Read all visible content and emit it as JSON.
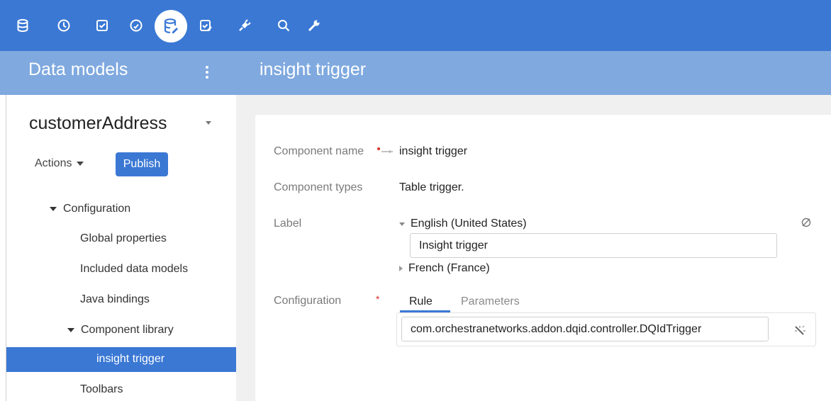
{
  "toolbar": {
    "icons": [
      "database-icon",
      "clock-icon",
      "checkbox-icon",
      "gauge-icon",
      "data-model-icon",
      "edit-check-icon",
      "plug-icon",
      "search-icon",
      "wrench-icon"
    ],
    "active_icon": "data-model-icon",
    "color": "#3a78d4"
  },
  "header": {
    "left_title": "Data models",
    "right_title": "insight trigger",
    "color": "#7fa9df"
  },
  "sidebar": {
    "model_name": "customerAddress",
    "actions_label": "Actions",
    "publish_label": "Publish",
    "tree": {
      "configuration": "Configuration",
      "global_properties": "Global properties",
      "included_data_models": "Included data models",
      "java_bindings": "Java bindings",
      "component_library": "Component library",
      "selected_item": "insight trigger",
      "toolbars": "Toolbars"
    }
  },
  "form": {
    "component_name_label": "Component name",
    "component_name_value": "insight trigger",
    "component_types_label": "Component types",
    "component_types_value": "Table trigger.",
    "label_label": "Label",
    "lang_english": "English (United States)",
    "english_value": "Insight trigger",
    "lang_french": "French (France)",
    "configuration_label": "Configuration",
    "tabs": [
      "Rule",
      "Parameters"
    ],
    "active_tab": "Rule",
    "rule_value": "com.orchestranetworks.addon.dqid.controller.DQIdTrigger"
  },
  "colors": {
    "accent": "#3a78d4",
    "required": "#d9342b"
  }
}
